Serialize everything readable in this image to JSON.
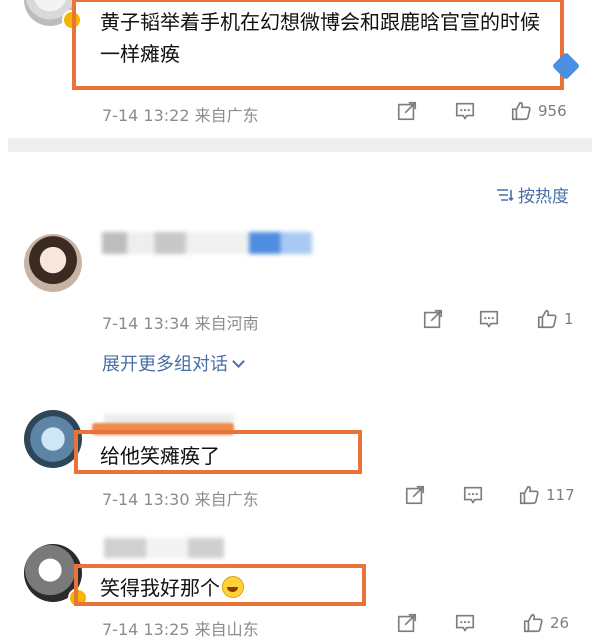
{
  "comments": [
    {
      "text": "黄子韬举着手机在幻想微博会和跟鹿晗官宣的时候一样瘫痪",
      "meta": "7-14 13:22 来自广东",
      "likes": "956"
    },
    {
      "text": "",
      "meta": "7-14 13:34 来自河南",
      "likes": "1",
      "expand_label": "展开更多组对话"
    },
    {
      "text": "给他笑瘫痪了",
      "meta": "7-14 13:30 来自广东",
      "likes": "117"
    },
    {
      "text": "笑得我好那个",
      "meta": "7-14 13:25 来自山东",
      "likes": "26",
      "emoji_icon": "laugh-cry-icon"
    }
  ],
  "sort": {
    "label": "按热度",
    "icon": "sort-lines-icon"
  },
  "icons": {
    "share": "share-icon",
    "comment": "comment-icon",
    "like": "thumbs-up-icon"
  },
  "colors": {
    "highlight": "#e8743a",
    "link": "#4a6fa5",
    "meta": "#8c8c8c"
  }
}
